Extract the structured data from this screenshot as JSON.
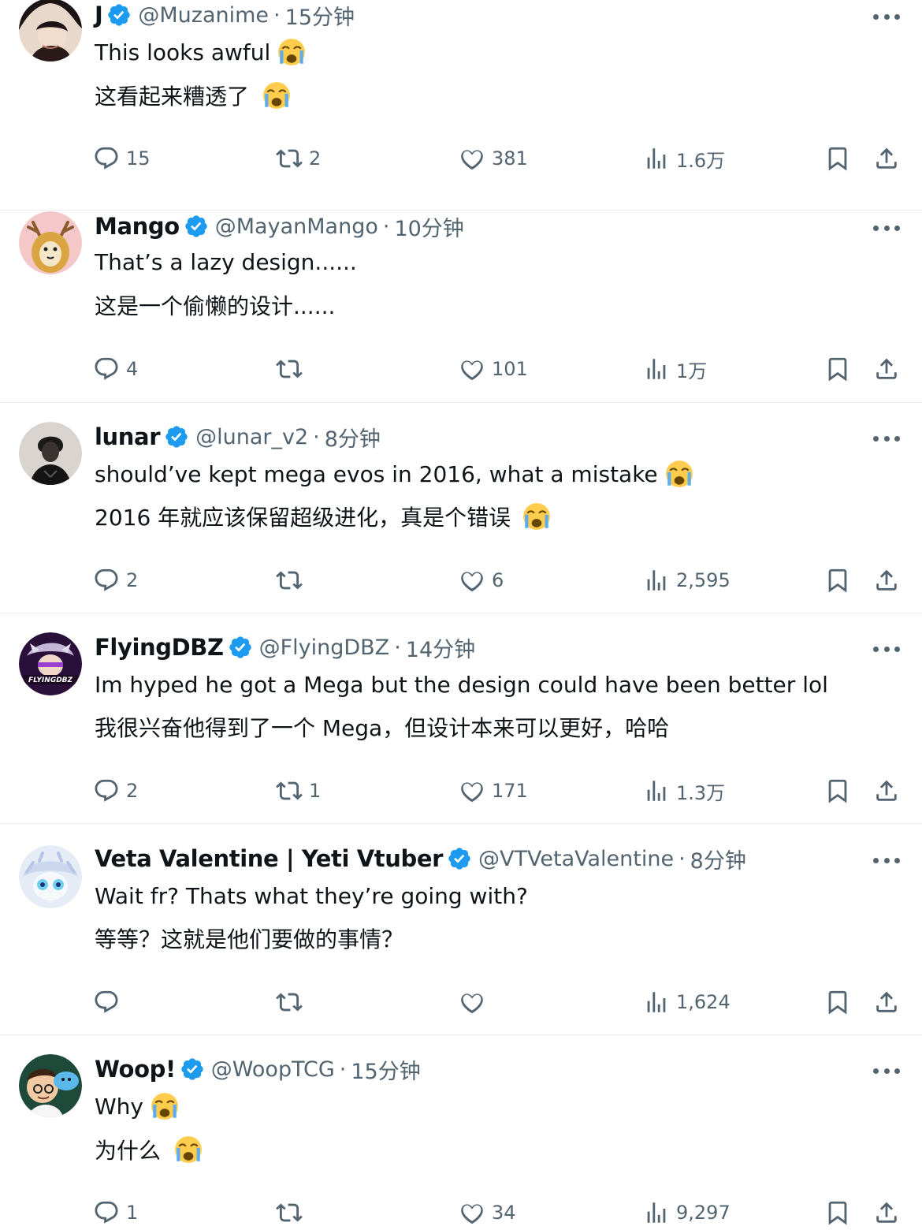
{
  "icons": {
    "verified": "verified-badge-icon",
    "more": "more-icon",
    "reply": "reply-icon",
    "repost": "repost-icon",
    "like": "like-icon",
    "views": "views-icon",
    "bookmark": "bookmark-icon",
    "share": "share-icon",
    "emoji": "loudly-crying-face-emoji"
  },
  "colors": {
    "verified": "#1d9bf0",
    "text": "#0f1419",
    "muted": "#536471",
    "divider": "#e6ecf0"
  },
  "posts": [
    {
      "name": "J",
      "handle": "@Muzanime",
      "sep": "·",
      "time": "15分钟",
      "text_en": "This looks awful",
      "text_zh": "这看起来糟透了",
      "replies": "15",
      "reposts": "2",
      "likes": "381",
      "views": "1.6万"
    },
    {
      "name": "Mango",
      "handle": "@MayanMango",
      "sep": "·",
      "time": "10分钟",
      "text_en": "That’s a lazy design......",
      "text_zh": "这是一个偷懒的设计......",
      "replies": "4",
      "reposts": "",
      "likes": "101",
      "views": "1万"
    },
    {
      "name": "lunar",
      "handle": "@lunar_v2",
      "sep": "·",
      "time": "8分钟",
      "text_en": "should’ve kept mega evos in 2016, what a mistake",
      "text_zh": "2016 年就应该保留超级进化，真是个错误",
      "replies": "2",
      "reposts": "",
      "likes": "6",
      "views": "2,595"
    },
    {
      "name": "FlyingDBZ",
      "handle": "@FlyingDBZ",
      "sep": "·",
      "time": "14分钟",
      "text_en": "Im hyped he got a Mega but the design could have been better lol",
      "text_zh": "我很兴奋他得到了一个 Mega，但设计本来可以更好，哈哈",
      "replies": "2",
      "reposts": "1",
      "likes": "171",
      "views": "1.3万",
      "avatar_text": "FLYINGDBZ"
    },
    {
      "name": "Veta Valentine | Yeti Vtuber",
      "handle": "@VTVetaValentine",
      "sep": "·",
      "time": "8分钟",
      "text_en": "Wait fr? Thats what they’re going with?",
      "text_zh": "等等？这就是他们要做的事情？",
      "replies": "",
      "reposts": "",
      "likes": "",
      "views": "1,624"
    },
    {
      "name": "Woop!",
      "handle": "@WoopTCG",
      "sep": "·",
      "time": "15分钟",
      "text_en": "Why",
      "text_zh": "为什么",
      "replies": "1",
      "reposts": "",
      "likes": "34",
      "views": "9,297"
    }
  ]
}
